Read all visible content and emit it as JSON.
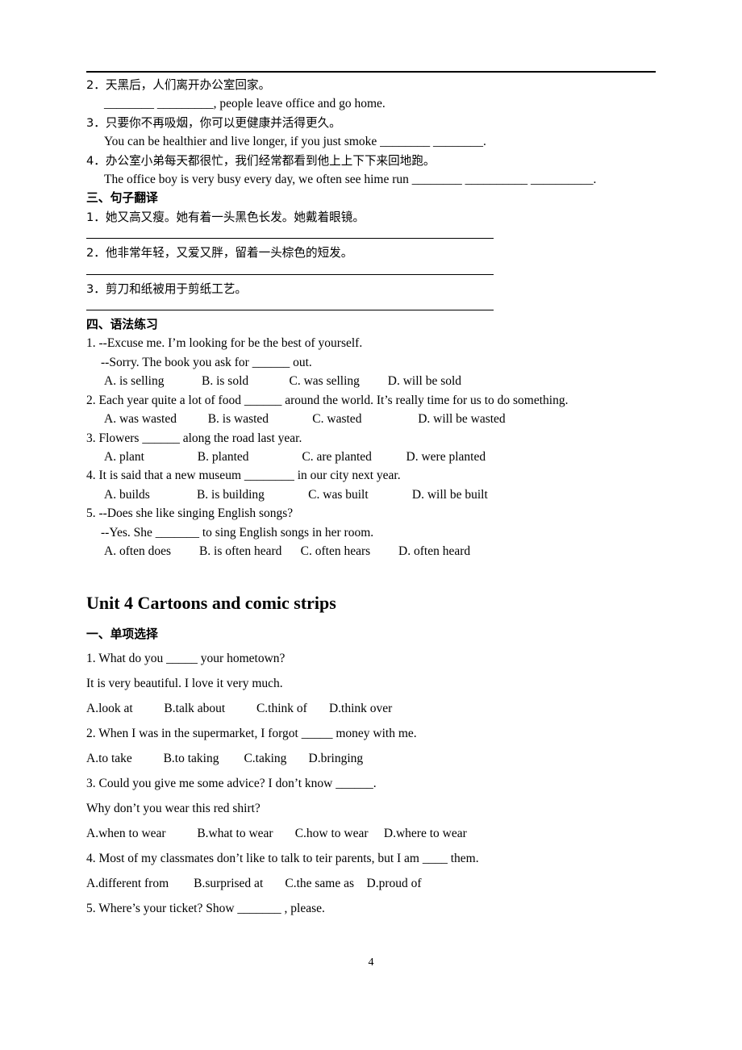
{
  "page": {
    "number": "4",
    "sections": {
      "fill_blanks_tail": {
        "items": [
          {
            "cn": "2．天黑后，人们离开办公室回家。",
            "en": "________ _________, people leave office and go home."
          },
          {
            "cn": "3．只要你不再吸烟，你可以更健康并活得更久。",
            "en": "You can be healthier and live longer, if you just smoke ________ ________."
          },
          {
            "cn": "4．办公室小弟每天都很忙，我们经常都看到他上上下下来回地跑。",
            "en": "The office boy is very busy every day, we often see hime run ________ __________ __________."
          }
        ]
      },
      "translation": {
        "heading": "三、句子翻译",
        "items": [
          "1．她又高又瘦。她有着一头黑色长发。她戴着眼镜。",
          "2．他非常年轻，又爱又胖，留着一头棕色的短发。",
          "3．剪刀和纸被用于剪纸工艺。"
        ]
      },
      "grammar": {
        "heading": "四、语法练习",
        "questions": [
          {
            "stem": "1. --Excuse me. I’m looking for be the best of yourself.",
            "stem2": "--Sorry. The book you ask for ______ out.",
            "options": "A. is selling            B. is sold             C. was selling         D. will be sold"
          },
          {
            "stem": "2. Each year quite a lot of food ______ around the world. It’s really time for us to do something.",
            "options": "A. was wasted          B. is wasted              C. wasted                  D. will be wasted"
          },
          {
            "stem": "3. Flowers ______ along the road last year.",
            "options": "A. plant                 B. planted                 C. are planted           D. were planted"
          },
          {
            "stem": "4. It is said that a new museum ________ in our city next year.",
            "options": "A. builds               B. is building              C. was built              D. will be built"
          },
          {
            "stem": "5. --Does she like singing English songs?",
            "stem2": "--Yes. She _______ to sing English songs in her room.",
            "options": "A. often does         B. is often heard      C. often hears         D. often heard"
          }
        ]
      },
      "unit4": {
        "title": "Unit 4 Cartoons and comic strips",
        "heading": "一、单项选择",
        "questions": [
          {
            "stem": "1. What do you _____ your hometown?",
            "stem2": "It is very beautiful. I love it very much.",
            "options": "A.look at          B.talk about          C.think of       D.think over"
          },
          {
            "stem": "2. When I was in the supermarket, I forgot _____ money with me.",
            "options": "A.to take          B.to taking        C.taking       D.bringing"
          },
          {
            "stem": "3. Could you give me some advice? I don’t know ______.",
            "stem2": "Why don’t you wear this red shirt?",
            "options": "A.when to wear          B.what to wear       C.how to wear     D.where to wear"
          },
          {
            "stem": "4. Most of my classmates don’t like to talk to teir parents, but I am ____ them.",
            "options": "A.different from        B.surprised at       C.the same as    D.proud of"
          },
          {
            "stem": "5. Where’s your ticket? Show _______ , please.",
            "options": ""
          }
        ]
      }
    }
  }
}
